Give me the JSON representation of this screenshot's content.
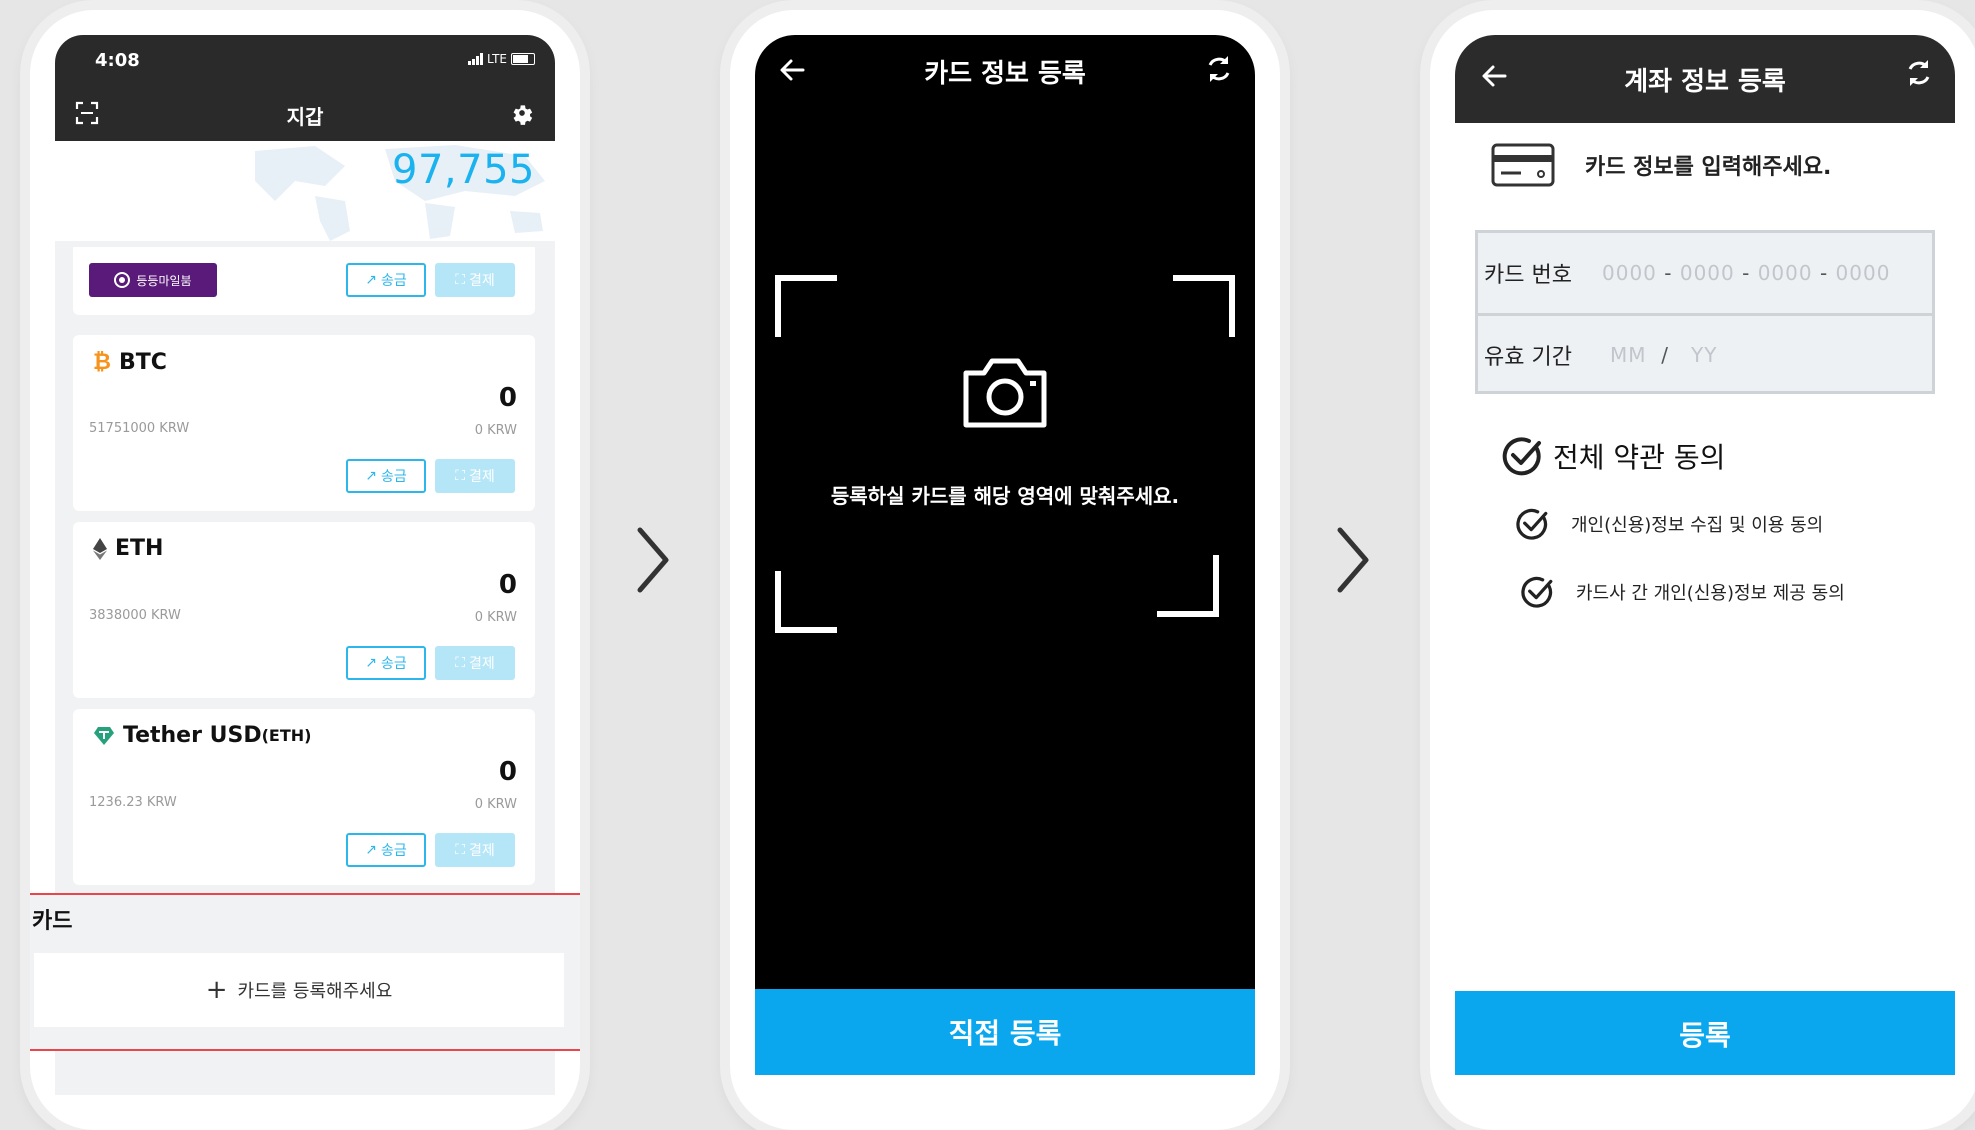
{
  "colors": {
    "accent": "#1ab3ef",
    "cta": "#0ba7ee",
    "badge": "#5a1a7a",
    "highlight": "#e8454c"
  },
  "wallet_screen": {
    "status": {
      "time": "4:08",
      "network": "LTE"
    },
    "title": "지갑",
    "balance": "97,755",
    "promo_badge": "등등마일붐",
    "send_label": "송금",
    "pay_label": "결제",
    "coins": [
      {
        "name": "BTC",
        "sub": "",
        "amount": "0",
        "price": "51751000 KRW",
        "krw": "0 KRW",
        "icon": "bitcoin-icon"
      },
      {
        "name": "ETH",
        "sub": "",
        "amount": "0",
        "price": "3838000 KRW",
        "krw": "0 KRW",
        "icon": "ethereum-icon"
      },
      {
        "name": "Tether USD",
        "sub": "(ETH)",
        "amount": "0",
        "price": "1236.23 KRW",
        "krw": "0 KRW",
        "icon": "tether-icon"
      }
    ],
    "card_section": {
      "label": "카드",
      "add_label": "카드를 등록해주세요"
    }
  },
  "scan_screen": {
    "title": "카드 정보 등록",
    "message": "등록하실 카드를 해당 영역에 맞춰주세요.",
    "cta": "직접 등록"
  },
  "form_screen": {
    "title": "계좌 정보 등록",
    "intro": "카드 정보를 입력해주세요.",
    "card_number_label": "카드 번호",
    "card_number_placeholder": [
      "0000",
      "0000",
      "0000",
      "0000"
    ],
    "expiry_label": "유효 기간",
    "expiry_placeholder": [
      "MM",
      "YY"
    ],
    "agree_all": "전체 약관 동의",
    "agreements": [
      "개인(신용)정보 수집 및 이용 동의",
      "카드사 간 개인(신용)정보 제공 동의"
    ],
    "cta": "등록"
  }
}
